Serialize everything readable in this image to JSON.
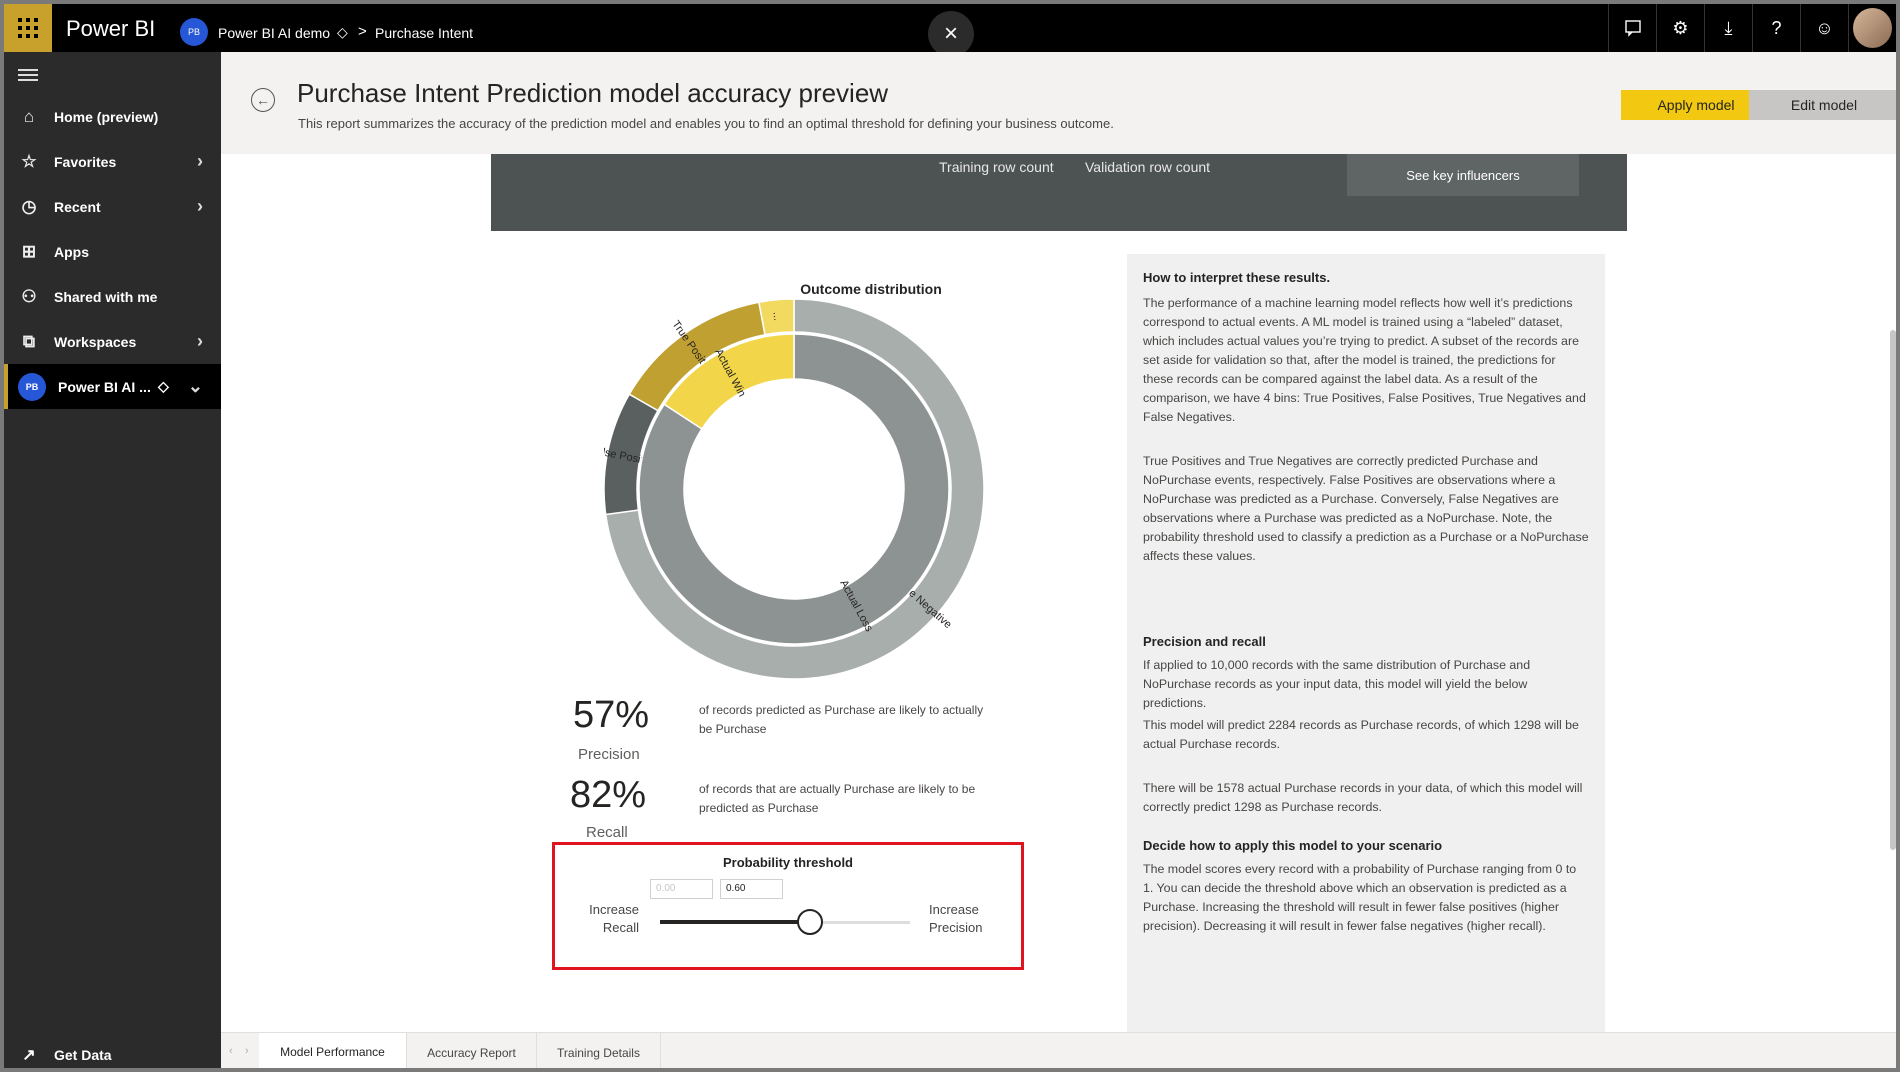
{
  "topbar": {
    "brand": "Power BI",
    "workspace_initials": "PB",
    "workspace_name": "Power BI AI demo",
    "breadcrumb_separator": ">",
    "report_name": "Purchase Intent",
    "close_symbol": "×",
    "icons": [
      "comment-icon",
      "settings-icon",
      "download-icon",
      "help-icon",
      "feedback-icon",
      "profile-avatar"
    ]
  },
  "sidebar": {
    "items": [
      {
        "label": "Home (preview)",
        "icon": "home-icon"
      },
      {
        "label": "Favorites",
        "icon": "star-icon"
      },
      {
        "label": "Recent",
        "icon": "clock-icon"
      },
      {
        "label": "Apps",
        "icon": "apps-icon"
      },
      {
        "label": "Shared with me",
        "icon": "shared-icon"
      },
      {
        "label": "Workspaces",
        "icon": "workspaces-icon"
      }
    ],
    "current_workspace": {
      "initials": "PB",
      "label": "Power BI AI ..."
    },
    "get_data": "Get Data"
  },
  "header": {
    "title": "Purchase Intent Prediction model accuracy preview",
    "subtitle": "This report summarizes the accuracy of the prediction model and enables you to find an optimal threshold for defining your business outcome.",
    "apply_label": "Apply model",
    "edit_label": "Edit model"
  },
  "banner": {
    "training_label": "Training row count",
    "validation_label": "Validation row count",
    "influencers_label": "See key influencers"
  },
  "chart_data": {
    "type": "pie",
    "title": "Outcome distribution",
    "outer_ring": [
      {
        "label": "True Negative",
        "value": 6900,
        "color": "#a8aeac"
      },
      {
        "label": "False Positive",
        "value": 990,
        "color": "#5a605f"
      },
      {
        "label": "True Positive",
        "value": 1300,
        "color": "#bfa031"
      },
      {
        "label": "...",
        "value": 280,
        "color": "#f2d960"
      }
    ],
    "inner_ring": [
      {
        "label": "Actual Loss",
        "value": 8420,
        "color": "#8d9392"
      },
      {
        "label": "Actual Win",
        "value": 1580,
        "color": "#f2d548"
      }
    ]
  },
  "metrics": {
    "precision_value": "57%",
    "precision_label": "Precision",
    "precision_desc": "of records predicted as Purchase are likely to actually be Purchase",
    "recall_value": "82%",
    "recall_label": "Recall",
    "recall_desc": "of records that are actually Purchase are likely to be predicted as Purchase"
  },
  "threshold": {
    "title": "Probability threshold",
    "min_value": "0.00",
    "current_value": "0.60",
    "position": 0.6,
    "left_label_1": "Increase",
    "left_label_2": "Recall",
    "right_label_1": "Increase",
    "right_label_2": "Precision"
  },
  "panel": {
    "h1": "How to interpret these results.",
    "p1": "The performance of a machine learning model reflects how well it’s predictions correspond to actual events.  A ML model is trained using a “labeled” dataset, which includes actual values you’re trying to predict.  A subset of the records are set aside for validation so that, after the model is trained, the predictions for these records can be compared against the label data.  As a result of the comparison, we have 4 bins:  True Positives, False Positives, True Negatives and False Negatives.",
    "p2": "True Positives and True Negatives are correctly predicted Purchase and NoPurchase events, respectively.  False Positives are observations where a NoPurchase was predicted as a Purchase.  Conversely, False Negatives are observations where a Purchase was predicted as a NoPurchase.  Note, the probability threshold used to classify a prediction as a Purchase or a NoPurchase affects these values.",
    "h2": "Precision and recall",
    "p3": "If applied to 10,000 records with the same distribution of Purchase and NoPurchase records as your input data, this model will yield the below predictions.",
    "p4": "This model will predict 2284 records as Purchase records, of which 1298 will be actual Purchase records.",
    "p5": "There will be 1578 actual Purchase records in your data, of which this model will correctly predict 1298 as Purchase records.",
    "h3": "Decide how to apply this model to your scenario",
    "p6": "The model scores every record with a probability of Purchase ranging from 0 to 1.  You can decide the threshold above which an observation is predicted as a Purchase. Increasing the threshold will result in fewer false positives (higher precision). Decreasing it will result in fewer false negatives (higher recall)."
  },
  "tabs": {
    "prev": "‹",
    "next": "›",
    "items": [
      "Model Performance",
      "Accuracy Report",
      "Training Details"
    ]
  }
}
